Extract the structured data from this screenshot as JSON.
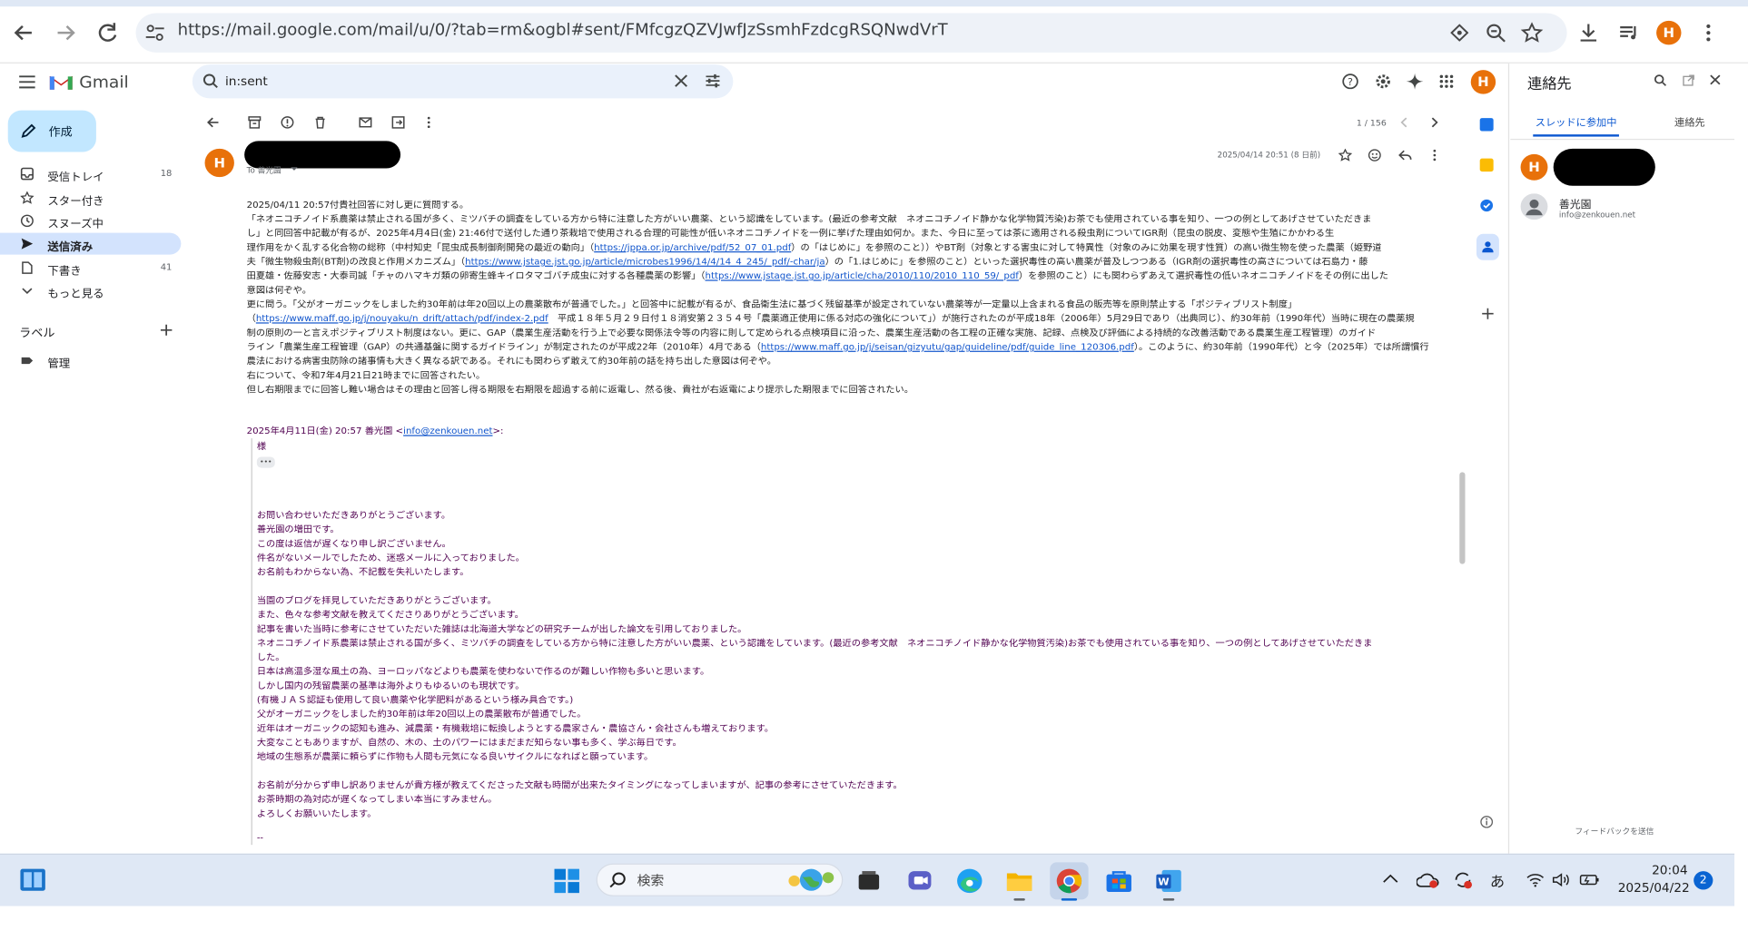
{
  "browser": {
    "url": "https://mail.google.com/mail/u/0/?tab=rm&ogbl#sent/FMfcgzQZVJwfJzSsmhFzdcgRSQNwdVrT",
    "profile_initial": "H"
  },
  "gmail": {
    "logo_text": "Gmail",
    "search_query": "in:sent",
    "avatar_initial": "H"
  },
  "sidebar": {
    "compose_label": "作成",
    "items": [
      {
        "label": "受信トレイ",
        "count": "18"
      },
      {
        "label": "スター付き",
        "count": ""
      },
      {
        "label": "スヌーズ中",
        "count": ""
      },
      {
        "label": "送信済み",
        "count": ""
      },
      {
        "label": "下書き",
        "count": "41"
      },
      {
        "label": "もっと見る",
        "count": ""
      }
    ],
    "labels_heading": "ラベル",
    "labels": [
      {
        "label": "管理"
      }
    ]
  },
  "toolbar": {
    "pagination": "1 / 156"
  },
  "message": {
    "sender_initial": "H",
    "to_line": "To 善光園",
    "date": "2025/04/14 20:51 (8 日前)",
    "body": [
      "2025/04/11 20:57付貴社回答に対し更に質問する。",
      "「ネオニコチノイド系農薬は禁止される国が多く、ミツバチの調査をしている方から特に注意した方がいい農薬、という認識をしています。(最近の参考文献　ネオニコチノイド静かな化学物質汚染)お茶でも使用されている事を知り、一つの例としてあげさせていただきま",
      "し」と同回答中記載が有るが、2025年4月4日(金) 21:46付で送付した通り茶栽培で使用される合理的可能性が低いネオニコチノイドを一例に挙げた理由如何か。また、今日に至っては茶に適用される殺虫剤についてIGR剤（昆虫の脱皮、変態や生殖にかかわる生",
      "理作用をかく乱する化合物の総称（中村知史「昆虫成長制御剤開発の最近の動向」（https://jppa.or.jp/archive/pdf/52_07_01.pdf）の「はじめに」を参照のこと））やBT剤（対象とする害虫に対して特異性（対象のみに効果を現す性質）の高い微生物を使った農薬（姫野道",
      "夫「微生物殺虫剤(BT剤)の改良と作用メカニズム」（https://www.jstage.jst.go.jp/article/microbes1996/14/4/14_4_245/_pdf/-char/ja）の「1.はじめに」を参照のこと）といった選択毒性の高い農薬が普及しつつある（IGR剤の選択毒性の高さについては石島力・藤",
      "田夏雄・佐藤安志・大泰司誠「チャのハマキガ類の卵寄生蜂キイロタマゴバチ成虫に対する各種農薬の影響」（https://www.jstage.jst.go.jp/article/cha/2010/110/2010_110_59/_pdf）を参照のこと）にも関わらずあえて選択毒性の低いネオニコチノイドをその例に出した",
      "意図は何ぞや。",
      "更に問う。「父がオーガニックをしました約30年前は年20回以上の農薬散布が普通でした。」と回答中に記載が有るが、食品衛生法に基づく残留基準が設定されていない農薬等が一定量以上含まれる食品の販売等を原則禁止する「ポジティブリスト制度」",
      "（https://www.maff.go.jp/j/nouyaku/n_drift/attach/pdf/index-2.pdf　平成１８年５月２９日付１８消安第２３５４号「農薬適正使用に係る対応の強化について」）が施行されたのが平成18年（2006年）5月29日であり（出典同じ）、約30年前（1990年代）当時に現在の農薬規",
      "制の原則の一と言えポジティブリスト制度はない。更に、GAP（農業生産活動を行う上で必要な関係法令等の内容に則して定められる点検項目に沿った、農業生産活動の各工程の正確な実施、記録、点検及び評価による持続的な改善活動である農業生産工程管理）のガイド",
      "ライン「農業生産工程管理（GAP）の共通基盤に関するガイドライン」が制定されたのが平成22年（2010年）4月である（https://www.maff.go.jp/j/seisan/gizyutu/gap/guideline/pdf/guide_line_120306.pdf）。このように、約30年前（1990年代）と今（2025年）では所謂慣行",
      "農法における病害虫防除の諸事情も大きく異なる訳である。それにも関わらず敢えて約30年前の話を持ち出した意図は何ぞや。",
      "右について、令和7年4月21日21時までに回答されたい。",
      "但し右期限までに回答し難い場合はその理由と回答し得る期限を右期限を超過する前に返電し、然る後、貴社が右返電により提示した期限までに回答されたい。"
    ],
    "quote_header": "2025年4月11日(金) 20:57 善光園 <info@zenkouen.net>:",
    "quote_header_email": "info@zenkouen.net",
    "quote_salutation": "様",
    "quote_ellipsis": "•••",
    "quote_body": [
      "お問い合わせいただきありがとうございます。",
      "善光園の増田です。",
      "この度は返信が遅くなり申し訳ございません。",
      "件名がないメールでしたため、迷惑メールに入っておりました。",
      "お名前もわからない為、不記載を失礼いたします。",
      "",
      "当園のブログを拝見していただきありがとうございます。",
      "また、色々な参考文献を教えてくださりありがとうございます。",
      "記事を書いた当時に参考にさせていただいた雑誌は北海道大学などの研究チームが出した論文を引用しておりました。",
      "ネオニコチノイド系農薬は禁止される国が多く、ミツバチの調査をしている方から特に注意した方がいい農薬、という認識をしています。(最近の参考文献　ネオニコチノイド静かな化学物質汚染)お茶でも使用されている事を知り、一つの例としてあげさせていただきま",
      "した。",
      "日本は高温多湿な風土の為、ヨーロッパなどよりも農薬を使わないで作るのが難しい作物も多いと思います。",
      "しかし国内の残留農薬の基準は海外よりもゆるいのも現状です。",
      "(有機ＪＡＳ認証も使用して良い農薬や化学肥料があるという様み具合です。)",
      "父がオーガニックをしました約30年前は年20回以上の農薬散布が普通でした。",
      "近年はオーガニックの認知も進み、減農薬・有機栽培に転換しようとする農家さん・農協さん・会社さんも増えております。",
      "大変なこともありますが、自然の、木の、土のパワーにはまだまだ知らない事も多く、学ぶ毎日です。",
      "地域の生態系が農薬に頼らずに作物も人間も元気になる良いサイクルになればと願っています。",
      "",
      "お名前が分からず申し訳ありませんが貴方様が教えてくださった文献も時間が出来たタイミングになってしまいますが、記事の参考にさせていただきます。",
      "お茶時期の為対応が遅くなってしまい本当にすみません。",
      "よろしくお願いいたします。"
    ],
    "trailing": "--"
  },
  "right_panel": {
    "title": "連絡先",
    "tab_thread": "スレッドに参加中",
    "tab_contacts": "連絡先",
    "contact_name": "善光園",
    "contact_email": "info@zenkouen.net",
    "feedback": "フィードバックを送信"
  },
  "taskbar": {
    "search_placeholder": "検索",
    "time": "20:04",
    "date": "2025/04/22",
    "notification_count": "2",
    "ime": "あ"
  }
}
